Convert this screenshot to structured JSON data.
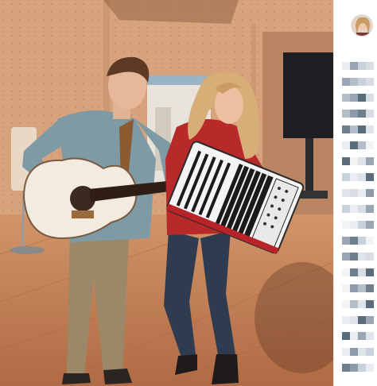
{
  "post": {
    "photo": {
      "scene": "guitar-and-accordion-duet",
      "colors": {
        "wall": "#d7a37c",
        "floor": "#c47f55",
        "guitar": "#f3ebe0",
        "accordion": "#f4f4f4",
        "shirt_man": "#7d9aa5",
        "pants_man": "#9a8868",
        "top_woman": "#b82a2a",
        "jeans_woman": "#2f3b4e",
        "hair_woman": "#d7ad78",
        "screen": "#1d1e22"
      }
    }
  },
  "sidebar": {
    "avatar_icon": "profile-avatar-icon",
    "content_state": "pixelated"
  }
}
